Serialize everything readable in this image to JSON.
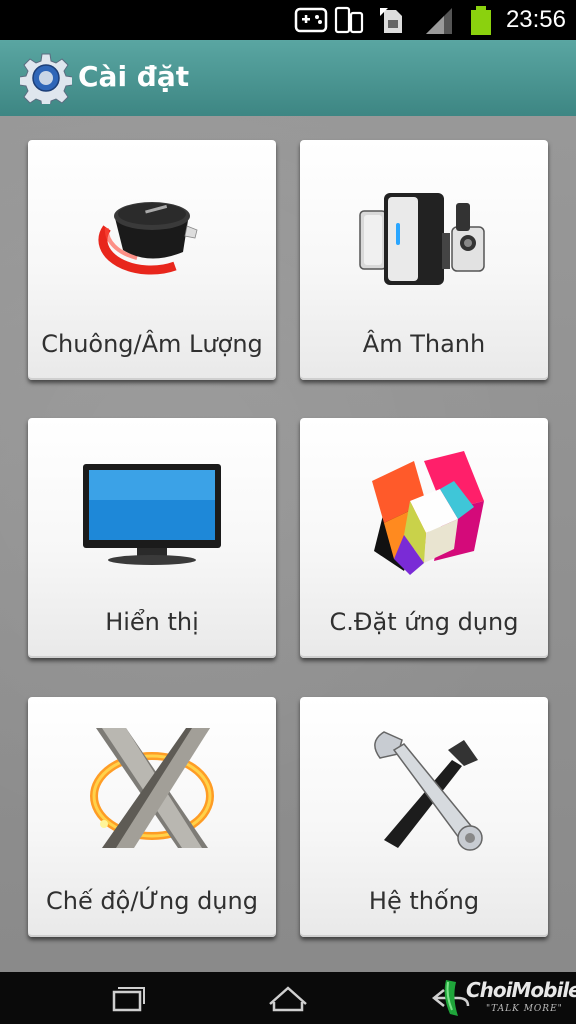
{
  "status_bar": {
    "time": "23:56",
    "icons": [
      "gamepad-icon",
      "phone-sync-icon",
      "sim-card-icon",
      "signal-icon",
      "battery-icon"
    ]
  },
  "action_bar": {
    "icon": "settings-gear-icon",
    "title": "Cài đặt"
  },
  "tiles": [
    {
      "label": "Chuông/Âm Lượng",
      "icon": "volume-knob-icon"
    },
    {
      "label": "Âm Thanh",
      "icon": "speakers-icon"
    },
    {
      "label": "Hiển thị",
      "icon": "monitor-icon"
    },
    {
      "label": "C.Đặt ứng dụng",
      "icon": "colorful-cubes-icon"
    },
    {
      "label": "Chế độ/Ứng dụng",
      "icon": "x-logo-icon"
    },
    {
      "label": "Hệ thống",
      "icon": "wrench-hammer-icon"
    }
  ],
  "nav_bar": {
    "buttons": [
      "recent-apps-icon",
      "home-icon",
      "back-icon"
    ]
  },
  "watermark": {
    "text": "ChoiMobile",
    "tagline": "\"TALK MORE\""
  },
  "colors": {
    "action_bar": "#4a9692",
    "background": "#8f8f8f",
    "tile": "#f4f4f4"
  }
}
